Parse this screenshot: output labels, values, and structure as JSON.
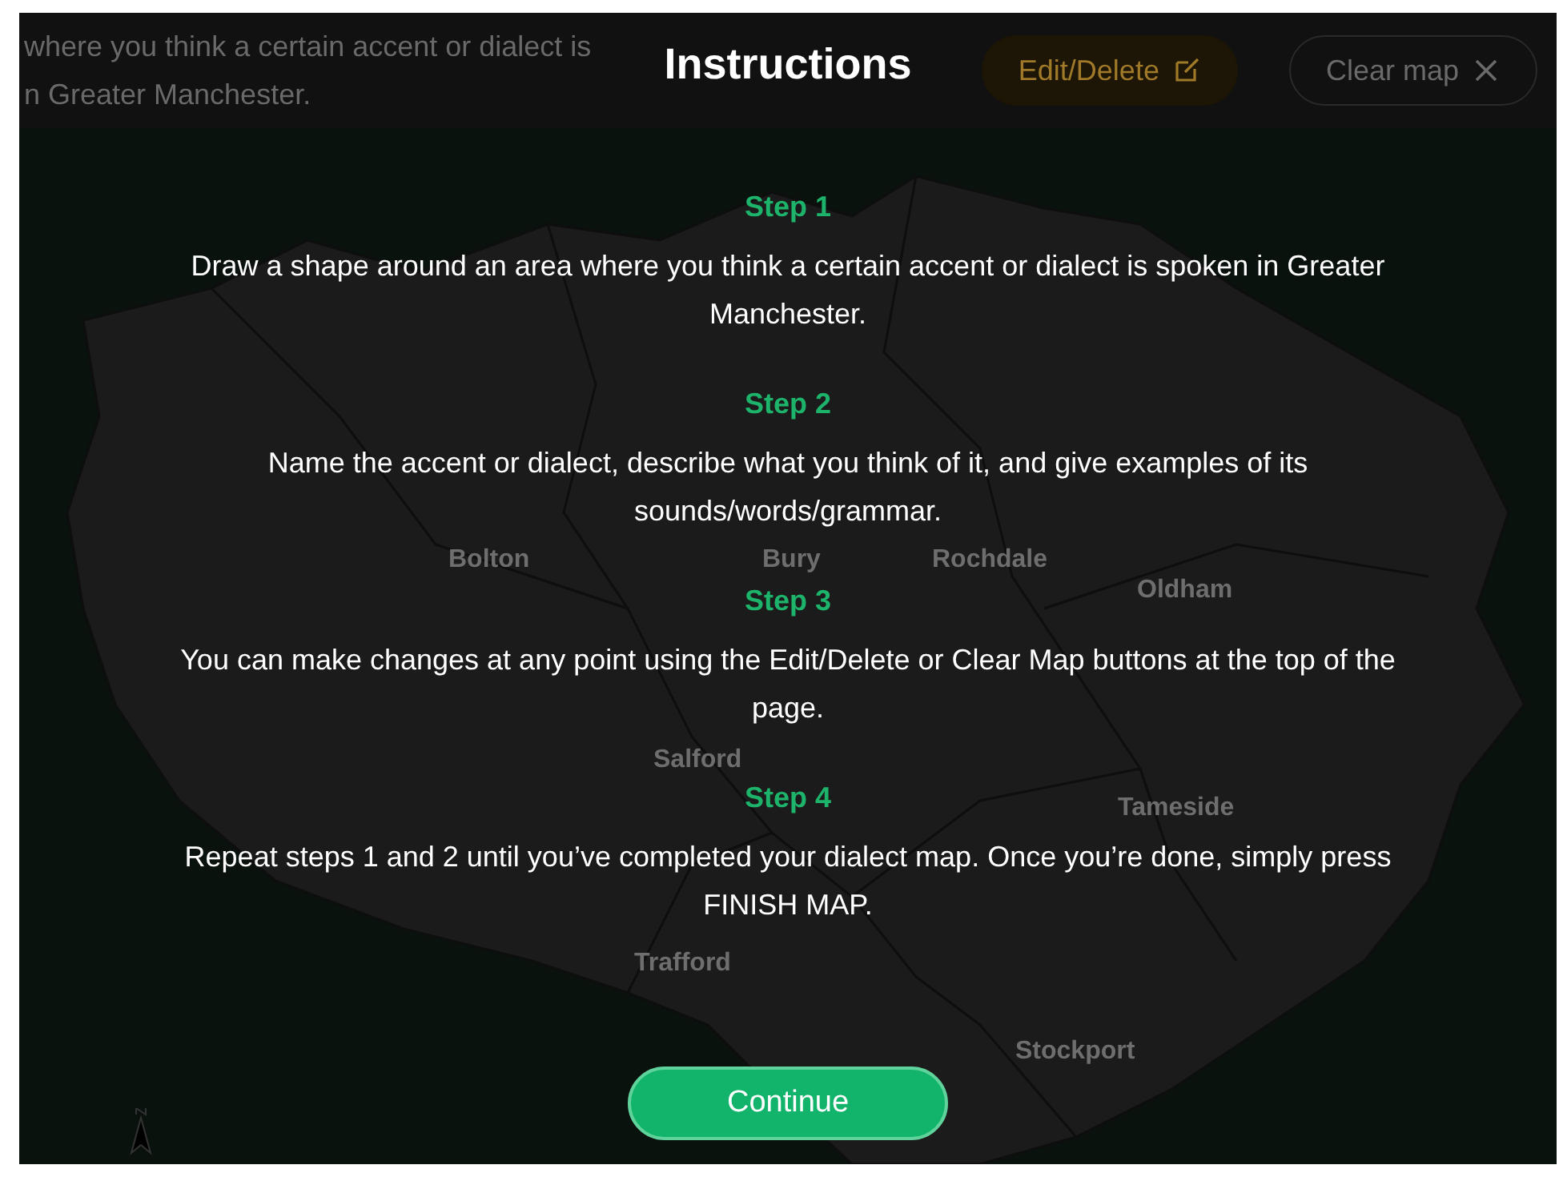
{
  "header": {
    "intro_lines": [
      "where you think a certain accent or dialect is",
      "n Greater Manchester."
    ],
    "buttons": [
      {
        "label": "Edit/Delete",
        "kind": "edit"
      },
      {
        "label": "Clear map",
        "kind": "clear"
      }
    ]
  },
  "map": {
    "labels": [
      "Bolton",
      "Bury",
      "Rochdale",
      "Oldham",
      "Salford",
      "Tameside",
      "Trafford",
      "Stockport"
    ]
  },
  "modal": {
    "title": "Instructions",
    "steps": [
      {
        "heading": "Step 1",
        "text": "Draw a shape around an area where you think a certain accent or dialect is spoken in Greater Manchester."
      },
      {
        "heading": "Step 2",
        "text": "Name the accent or dialect, describe what you think of it, and give examples of its sounds/words/grammar."
      },
      {
        "heading": "Step 3",
        "text": "You can make changes at any point using the Edit/Delete or Clear Map buttons at the top of the page."
      },
      {
        "heading": "Step 4",
        "text": "Repeat steps 1 and 2 until you’ve completed your dialect map. Once you’re done, simply press FINISH MAP."
      }
    ],
    "button": "Continue"
  }
}
